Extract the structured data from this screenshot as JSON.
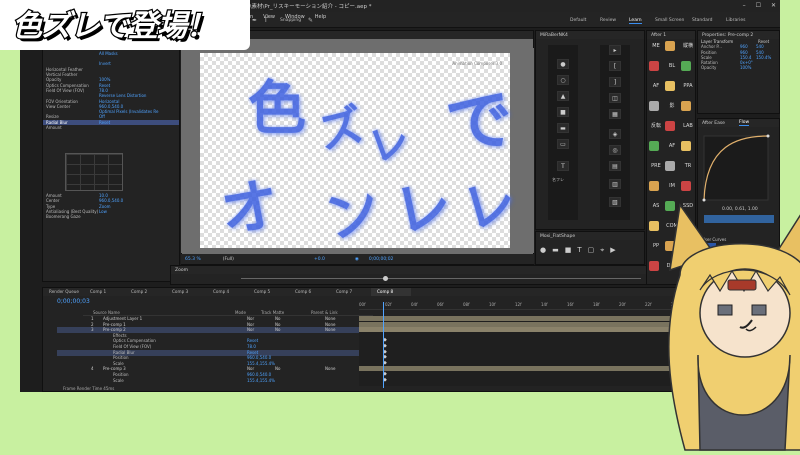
{
  "window": {
    "title": "Adobe After Effects 2025 - E:\\ファウスタ\\ギャラリー2025\\ナガンアニメーション紹介\\素材\\Pr_リスキーモーション紹介 - コピー.aep *"
  },
  "menu": [
    "File",
    "Edit",
    "Composition",
    "Layer",
    "Effect",
    "Animation",
    "View",
    "Window",
    "Help"
  ],
  "toolbar": {
    "snapping": "Snapping"
  },
  "workspaces": [
    {
      "label": "Default",
      "active": false
    },
    {
      "label": "Review",
      "active": false
    },
    {
      "label": "Learn",
      "active": true
    },
    {
      "label": "Small Screen",
      "active": false
    },
    {
      "label": "Standard",
      "active": false
    },
    {
      "label": "Libraries",
      "active": false
    }
  ],
  "effect_panel": {
    "rows": [
      {
        "label": "Opacity",
        "value": "",
        "sel": false
      },
      {
        "label": "Color",
        "value": "",
        "sel": false
      },
      {
        "label": "Color",
        "value": "",
        "sel": false
      },
      {
        "label": "",
        "value": "All Masks",
        "sel": false
      },
      {
        "label": "",
        "value": "",
        "sel": false
      },
      {
        "label": "",
        "value": "Invert",
        "sel": false
      },
      {
        "label": "Horizontal Feather",
        "value": "",
        "sel": false
      },
      {
        "label": "Vertical Feather",
        "value": "",
        "sel": false
      },
      {
        "label": "Opacity",
        "value": "100%",
        "sel": false
      },
      {
        "label": "Optics Compensation",
        "value": "Reset",
        "sel": false
      },
      {
        "label": "Field Of View (FOV)",
        "value": "78.0",
        "sel": false
      },
      {
        "label": "",
        "value": "Reverse Lens Distortion",
        "sel": false
      },
      {
        "label": "FOV Orientation",
        "value": "Horizontal",
        "sel": false
      },
      {
        "label": "View Center",
        "value": "960.0,540.0",
        "sel": false
      },
      {
        "label": "",
        "value": "Optimal Pixels (Invalidates Re",
        "sel": false
      },
      {
        "label": "Resize",
        "value": "Off",
        "sel": false
      },
      {
        "label": "Radial Blur",
        "value": "Reset",
        "sel": true
      },
      {
        "label": "Amount",
        "value": "",
        "sel": false
      }
    ],
    "lower_rows": [
      {
        "label": "Amount",
        "value": "10.0"
      },
      {
        "label": "Center",
        "value": "960.0,540.0"
      },
      {
        "label": "Type",
        "value": "Zoom"
      },
      {
        "label": "Antialiasing (Best Quality)",
        "value": "Low"
      },
      {
        "label": "Boomerang Gaze",
        "value": ""
      }
    ]
  },
  "viewer": {
    "tab": "AEJuice Pack Manager 4",
    "watermark": "Animation Composer 3.0",
    "chars": [
      "色",
      "ズ",
      "レ",
      "で",
      "登",
      "場",
      "オ",
      "レ",
      "で",
      "ン"
    ],
    "zoom": "65.3 %",
    "res": "(Full)",
    "frame_val": "+0.0",
    "timecode": "0;00;00;02"
  },
  "zoom_panel": {
    "label": "Zoom"
  },
  "tools_panel": {
    "tab": "MiRaBerNK4",
    "label": "名フレ"
  },
  "shape_panel": {
    "tab": "Moxi_FlatShape"
  },
  "effects_palette": {
    "tab": "After 1",
    "labels": [
      "ME",
      "縦横",
      "BL",
      "AF",
      "PPA",
      "影",
      "反転",
      "LAB",
      "AF",
      "PRE",
      "TR",
      "IM",
      "AS",
      "SSD",
      "COM",
      "PP",
      "ADD",
      "DUE"
    ]
  },
  "properties": {
    "title": "Properties: Pre-comp 2",
    "layer_transform": "Layer Transform",
    "reset": "Reset",
    "rows": [
      {
        "label": "Anchor P...",
        "value": "960",
        "value2": "540"
      },
      {
        "label": "Position",
        "value": "960",
        "value2": "540"
      },
      {
        "label": "Scale",
        "value": "150.4",
        "value2": "150.4%"
      },
      {
        "label": "Rotation",
        "value": "0x+0°",
        "value2": ""
      },
      {
        "label": "Opacity",
        "value": "100%",
        "value2": ""
      }
    ]
  },
  "flow": {
    "tab1": "After Ease",
    "tab2": "Flow",
    "values": "0.00, 0.61, 1.00",
    "user_curves": "User Curves",
    "curves_count": "12"
  },
  "timeline": {
    "tabs": [
      "Render Queue",
      "Comp 1",
      "Comp 2",
      "Comp 3",
      "Comp 4",
      "Comp 5",
      "Comp 6",
      "Comp 7",
      "Comp 8"
    ],
    "active_tab": "Comp 8",
    "timecode": "0;00;00;03",
    "headers": {
      "name": "Source Name",
      "mode": "Mode",
      "trkmat": "Track Matte",
      "parent": "Parent & Link"
    },
    "ruler": [
      "00f",
      "02f",
      "04f",
      "06f",
      "08f",
      "10f",
      "12f",
      "14f",
      "16f",
      "18f",
      "20f",
      "22f",
      "24f"
    ],
    "rows": [
      {
        "num": "1",
        "name": "Adjustment Layer 1",
        "mode": "Nor",
        "matte": "No",
        "parent": "None",
        "sel": false
      },
      {
        "num": "2",
        "name": "Pre-comp 1",
        "mode": "Nor",
        "matte": "No",
        "parent": "None",
        "sel": false
      },
      {
        "num": "3",
        "name": "Pre-comp 2",
        "mode": "Nor",
        "matte": "No",
        "parent": "None",
        "sel": true
      },
      {
        "num": "",
        "name": "Effects",
        "mode": "",
        "matte": "",
        "parent": "",
        "sel": false
      },
      {
        "num": "",
        "name": "Optics Compensation",
        "mode": "Reset",
        "matte": "",
        "parent": "",
        "sel": false
      },
      {
        "num": "",
        "name": "Field Of View (FOV)",
        "mode": "78.0",
        "matte": "",
        "parent": "",
        "sel": false
      },
      {
        "num": "",
        "name": "Radial Blur",
        "mode": "Reset",
        "matte": "",
        "parent": "",
        "sel": true
      },
      {
        "num": "",
        "name": "Position",
        "mode": "960.0,540.0",
        "matte": "",
        "parent": "",
        "sel": false
      },
      {
        "num": "",
        "name": "Scale",
        "mode": "155.4,155.4%",
        "matte": "",
        "parent": "",
        "sel": false
      },
      {
        "num": "4",
        "name": "Pre-comp 3",
        "mode": "Nor",
        "matte": "No",
        "parent": "None",
        "sel": false
      },
      {
        "num": "",
        "name": "Position",
        "mode": "960.0,540.0",
        "matte": "",
        "parent": "",
        "sel": false
      },
      {
        "num": "",
        "name": "Scale",
        "mode": "155.4,155.4%",
        "matte": "",
        "parent": "",
        "sel": false
      }
    ],
    "footer": "Frame Render Time 45ms"
  },
  "overlay": {
    "title": "色ズレで登場！"
  }
}
